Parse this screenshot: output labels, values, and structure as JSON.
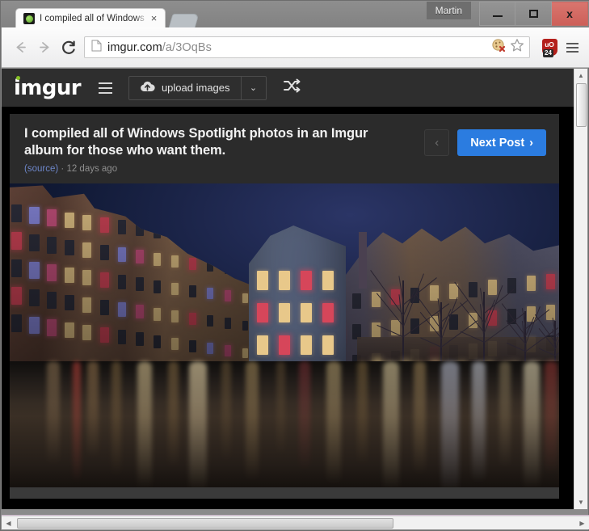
{
  "window": {
    "user_label": "Martin",
    "minimize_label": "–",
    "maximize_label": "□",
    "close_label": "x"
  },
  "browser": {
    "tab": {
      "title": "I compiled all of Windows",
      "close_label": "×",
      "favicon": "green-circle-favicon"
    },
    "new_tab_label": "",
    "back_label": "back-arrow",
    "forward_label": "forward-arrow",
    "reload_label": "reload-arrow",
    "omnibox": {
      "host": "imgur.com",
      "path": "/a/3OqBs",
      "page_icon": "document-icon",
      "cookie_blocked_icon": "cookie-blocked-icon",
      "bookmark_icon": "star-icon"
    },
    "extension": {
      "name": "uBlock Origin",
      "label": "uO",
      "count": "24"
    },
    "menu_label": "chrome-menu"
  },
  "imgur": {
    "logo": "imgur",
    "nav_menu_label": "navigation-menu",
    "upload_label": "upload images",
    "upload_caret_label": "⌄",
    "shuffle_label": "shuffle"
  },
  "post": {
    "title": "I compiled all of Windows Spotlight photos in an Imgur album for those who want them.",
    "source_label": "(source)",
    "separator": "·",
    "age": "12 days ago",
    "prev_label": "‹",
    "next_label": "Next Post",
    "next_chevron": "›"
  },
  "photo": {
    "description": "Amsterdam canal houses at blue hour with long-exposure light reflections on the water",
    "alt": "Windows Spotlight photo - Amsterdam canal at dusk"
  },
  "scrollbars": {
    "v_up": "▲",
    "v_down": "▼",
    "h_left": "◀",
    "h_right": "▶"
  },
  "colors": {
    "accent_blue": "#2b7ce0",
    "imgur_green": "#85bf25",
    "link_blue": "#6d86c9",
    "header_dark": "#2e2e2e",
    "post_dark": "#2b2b2b",
    "close_red": "#cd6059",
    "ublock_red": "#b4201c"
  }
}
